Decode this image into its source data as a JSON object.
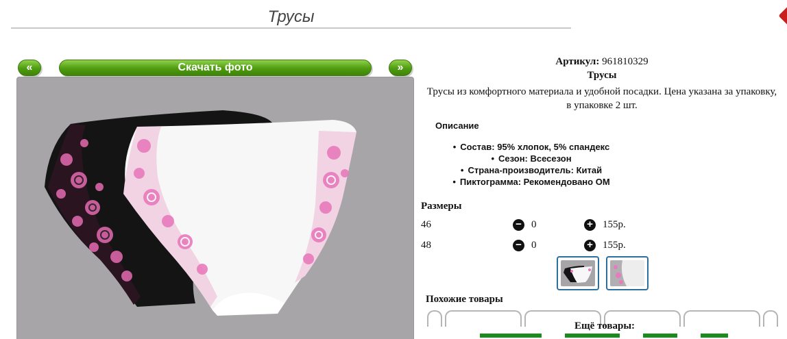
{
  "page": {
    "title": "Трусы"
  },
  "gallery": {
    "prev_label": "«",
    "next_label": "»",
    "download_label": "Скачать фото"
  },
  "product": {
    "article_label": "Артикул:",
    "article_value": "961810329",
    "name": "Трусы",
    "description": "Трусы из комфортного материала и удобной посадки. Цена указана за упаковку, в упаковке 2 шт."
  },
  "details": {
    "title": "Описание",
    "features": [
      "Состав: 95% хлопок, 5% спандекс",
      "Сезон: Всесезон",
      "Страна-производитель: Китай",
      "Пиктограмма: Рекомендовано ОМ"
    ]
  },
  "sizes": {
    "title": "Размеры",
    "rows": [
      {
        "size": "46",
        "minus_icon": "minus-icon",
        "qty": "0",
        "plus_icon": "plus-icon",
        "price": "155р."
      },
      {
        "size": "48",
        "minus_icon": "minus-icon",
        "qty": "0",
        "plus_icon": "plus-icon",
        "price": "155р."
      }
    ]
  },
  "similar": {
    "title": "Похожие товары"
  },
  "more": {
    "title": "Ещё товары:"
  },
  "colors": {
    "button_green": "#4f9b10",
    "photo_bg": "#a7a5a8",
    "thumb_border": "#2c6f9f",
    "link_green": "#1c8a1c",
    "lace_pink": "#e87bbd"
  }
}
